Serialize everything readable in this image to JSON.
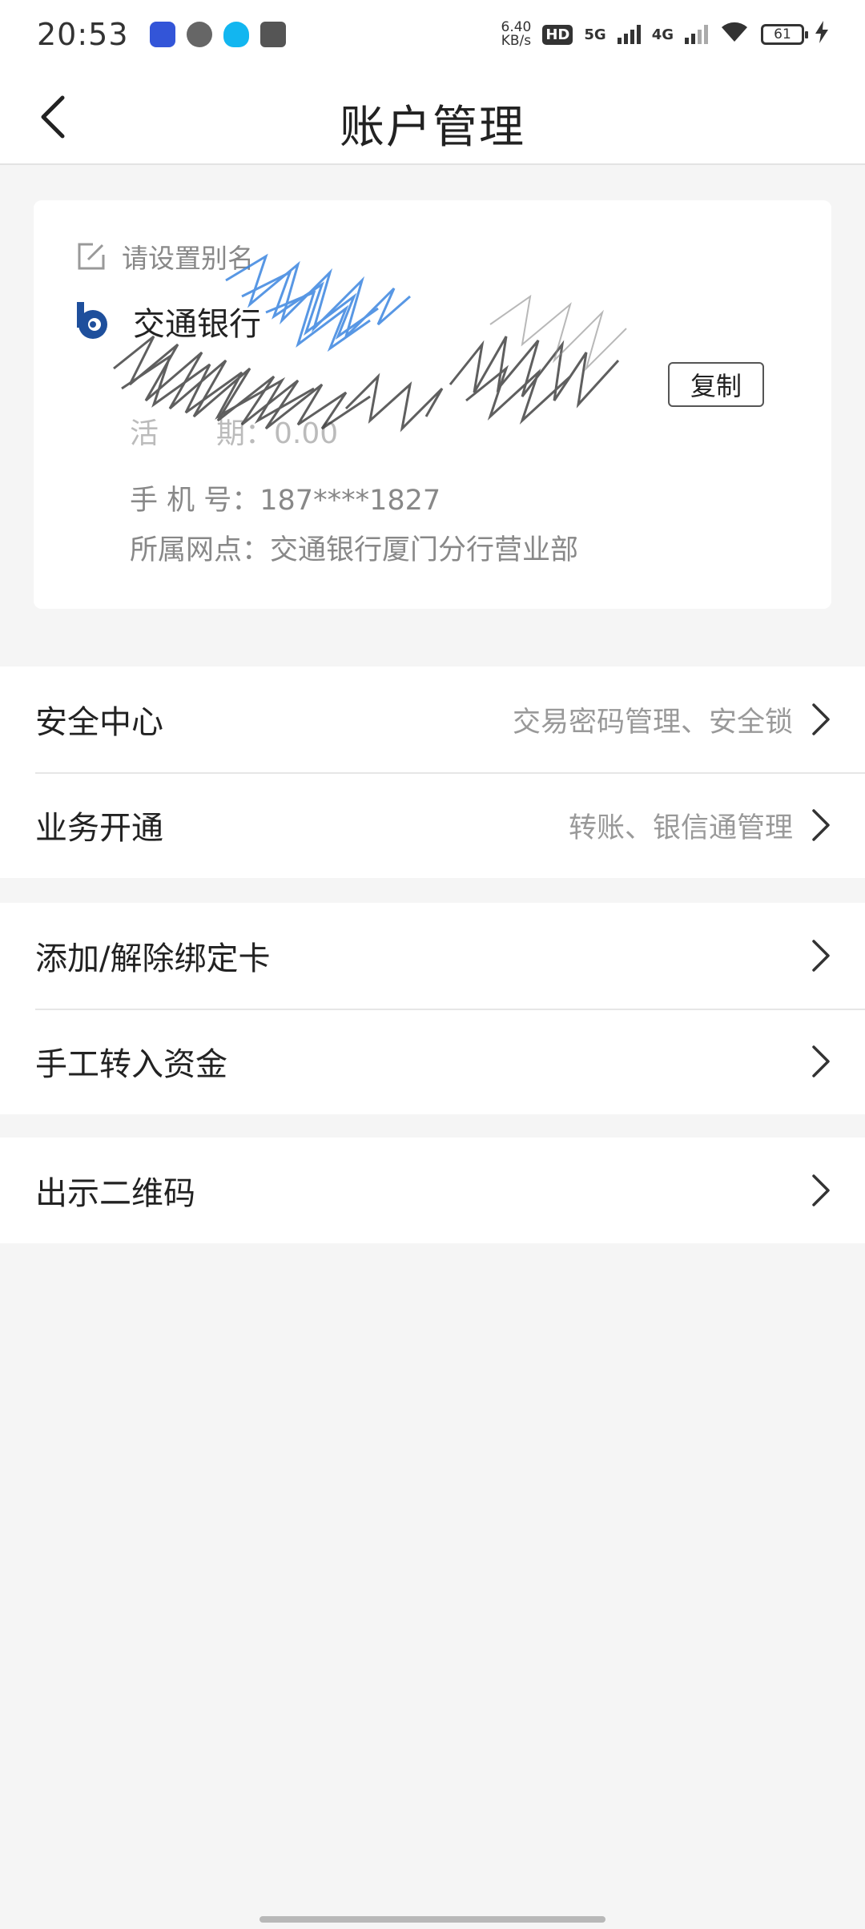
{
  "status_bar": {
    "time": "20:53",
    "speed_top": "6.40",
    "speed_unit": "KB/s",
    "hd_label": "HD",
    "net_5g": "5G",
    "net_4g": "4G",
    "battery": "61",
    "icons": [
      "app-icon",
      "chat-icon",
      "qq-icon",
      "message-icon",
      "wifi-icon",
      "battery-icon",
      "charging-icon"
    ]
  },
  "nav": {
    "title": "账户管理"
  },
  "card": {
    "alias_placeholder": "请设置别名",
    "bank_name": "交通银行",
    "copy_label": "复制",
    "balance": "活　　期：0.00",
    "phone_label": "手  机  号：",
    "phone_value": "187****1827",
    "branch_label": "所属网点：",
    "branch_value": "交通银行厦门分行营业部"
  },
  "menu_groups": [
    {
      "items": [
        {
          "label": "安全中心",
          "desc": "交易密码管理、安全锁"
        },
        {
          "label": "业务开通",
          "desc": "转账、银信通管理"
        }
      ]
    },
    {
      "items": [
        {
          "label": "添加/解除绑定卡"
        },
        {
          "label": "手工转入资金"
        }
      ]
    },
    {
      "items": [
        {
          "label": "出示二维码"
        }
      ]
    }
  ],
  "colors": {
    "background": "#f5f5f5",
    "card": "#ffffff",
    "brand_blue": "#1e4f9c"
  }
}
